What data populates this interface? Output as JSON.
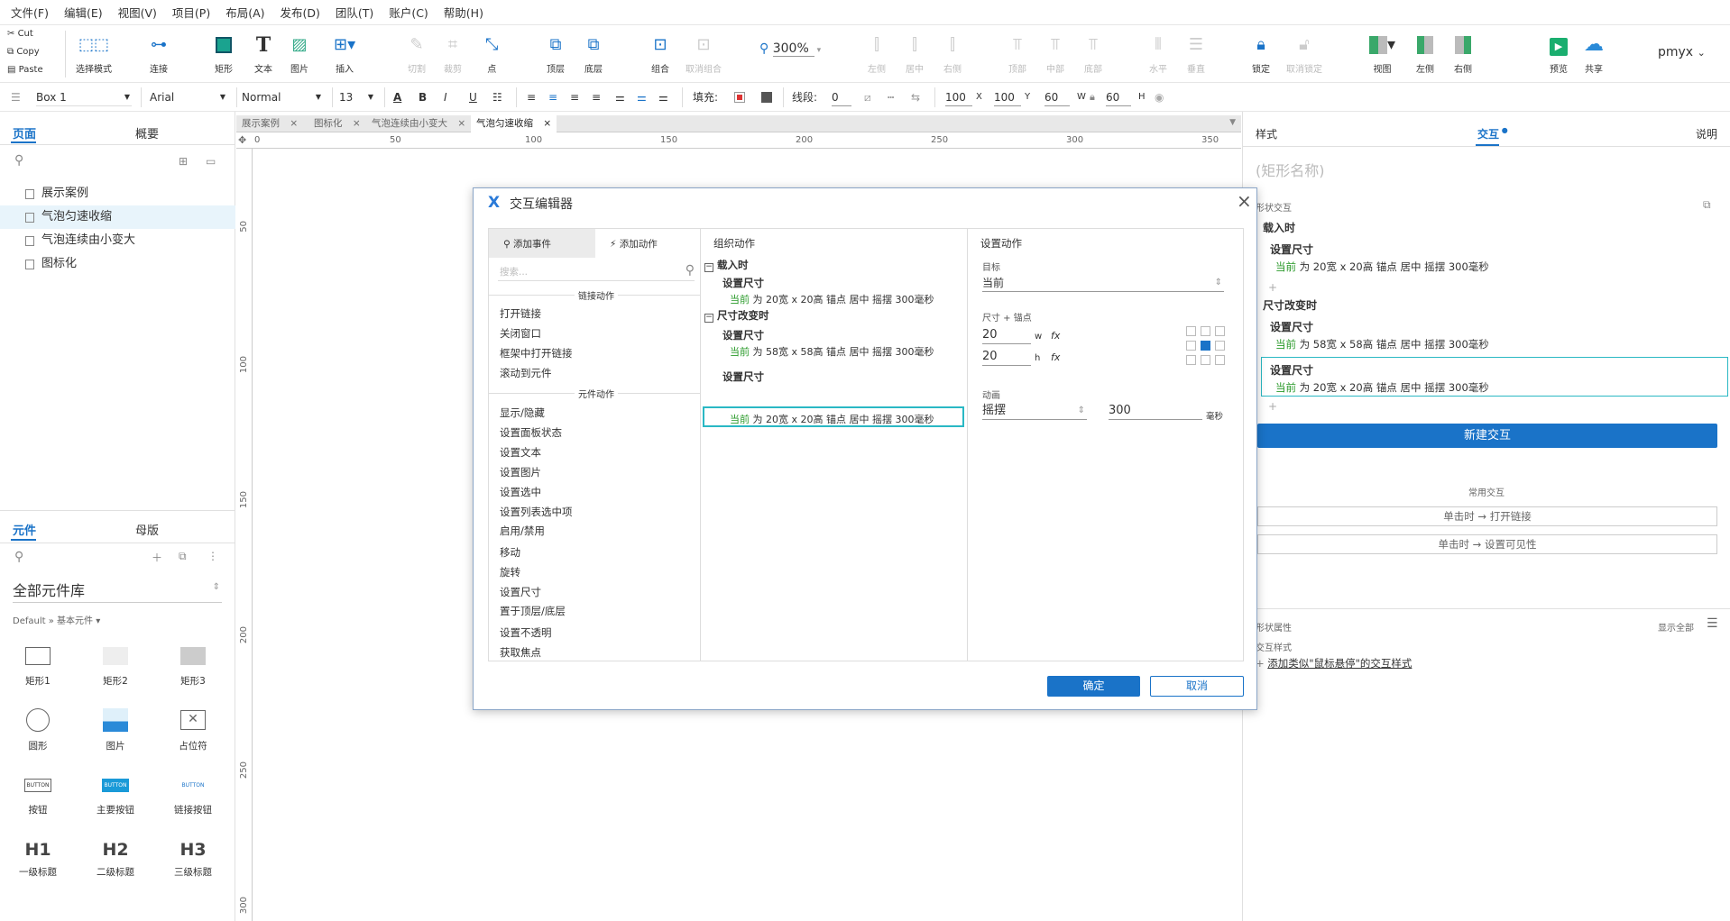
{
  "menu": [
    "文件(F)",
    "编辑(E)",
    "视图(V)",
    "项目(P)",
    "布局(A)",
    "发布(D)",
    "团队(T)",
    "账户(C)",
    "帮助(H)"
  ],
  "clipboard": {
    "cut": "Cut",
    "copy": "Copy",
    "paste": "Paste"
  },
  "toolbar": {
    "select_mode": "选择模式",
    "connect": "连接",
    "rect": "矩形",
    "text": "文本",
    "image": "图片",
    "insert": "插入",
    "cut": "切割",
    "crop": "裁剪",
    "point": "点",
    "top": "顶层",
    "bottom": "底层",
    "group": "组合",
    "ungroup": "取消组合",
    "zoom": "300%",
    "align_left": "左侧",
    "align_center": "居中",
    "align_right": "右侧",
    "align_top": "顶部",
    "align_middle": "中部",
    "align_bottom": "底部",
    "dist_h": "水平",
    "dist_v": "垂直",
    "lock": "锁定",
    "unlock": "取消锁定",
    "view": "视图",
    "left": "左侧",
    "right": "右侧",
    "preview": "预览",
    "share": "共享",
    "user": "pmyx"
  },
  "format": {
    "widget_name": "Box 1",
    "font": "Arial",
    "style": "Normal",
    "size": "13",
    "fill_label": "填充:",
    "line_label": "线段:",
    "line_value": "0",
    "x_value": "100",
    "x_label": "X",
    "y_value": "100",
    "y_label": "Y",
    "w_value": "60",
    "w_label": "W",
    "h_value": "60",
    "h_label": "H"
  },
  "left_panel": {
    "tab_pages": "页面",
    "tab_outline": "概要",
    "pages": [
      "展示案例",
      "气泡匀速收缩",
      "气泡连续由小变大",
      "图标化"
    ],
    "tab_widgets": "元件",
    "tab_masters": "母版",
    "library": "全部元件库",
    "breadcrumb": "Default » 基本元件 ▾",
    "widgets": [
      "矩形1",
      "矩形2",
      "矩形3",
      "圆形",
      "图片",
      "占位符",
      "按钮",
      "主要按钮",
      "链接按钮",
      "一级标题",
      "二级标题",
      "三级标题"
    ],
    "button_text": "BUTTON",
    "h1": "H1",
    "h2": "H2",
    "h3": "H3"
  },
  "canvas": {
    "tabs": [
      "展示案例",
      "图标化",
      "气泡连续由小变大",
      "气泡匀速收缩"
    ],
    "ruler_h": [
      "0",
      "50",
      "100",
      "150",
      "200",
      "250",
      "300",
      "350"
    ],
    "ruler_v": [
      "50",
      "100",
      "150",
      "200",
      "250",
      "300"
    ]
  },
  "dialog": {
    "title": "交互编辑器",
    "tab_add_event": "添加事件",
    "tab_add_action": "添加动作",
    "search_placeholder": "搜索...",
    "link_group": "链接动作",
    "link_actions": [
      "打开链接",
      "关闭窗口",
      "框架中打开链接",
      "滚动到元件"
    ],
    "widget_group": "元件动作",
    "widget_actions": [
      "显示/隐藏",
      "设置面板状态",
      "设置文本",
      "设置图片",
      "设置选中",
      "设置列表选中项",
      "启用/禁用",
      "移动",
      "旋转",
      "设置尺寸",
      "置于顶层/底层",
      "设置不透明",
      "获取焦点"
    ],
    "organize_title": "组织动作",
    "event_onload": "载入时",
    "event_onresize": "尺寸改变时",
    "action_name": "设置尺寸",
    "detail_current": "当前",
    "detail_20": "为 20宽 x 20高 锚点 居中 摇摆 300毫秒",
    "detail_58": "为 58宽 x 58高 锚点 居中 摇摆 300毫秒",
    "config_title": "设置动作",
    "target_label": "目标",
    "target_value": "当前",
    "size_anchor_label": "尺寸 + 锚点",
    "w_value": "20",
    "w_unit": "w",
    "h_value": "20",
    "h_unit": "h",
    "fx": "fx",
    "anim_label": "动画",
    "anim_value": "摇摆",
    "duration": "300",
    "ms": "毫秒",
    "ok": "确定",
    "cancel": "取消",
    "close": "×"
  },
  "right_panel": {
    "tab_style": "样式",
    "tab_interact": "交互",
    "tab_notes": "说明",
    "name_placeholder": "(矩形名称)",
    "shape_interactions": "形状交互",
    "new_interaction": "新建交互",
    "common": "常用交互",
    "common1": "单击时 → 打开链接",
    "common2": "单击时 → 设置可见性",
    "shape_props": "形状属性",
    "show_all": "显示全部",
    "interaction_styles": "交互样式",
    "add_style": "添加类似\"鼠标悬停\"的交互样式"
  },
  "colors": {
    "accent": "#1a73c8",
    "green": "#2a9a2a",
    "selection": "#2ab8c4"
  }
}
